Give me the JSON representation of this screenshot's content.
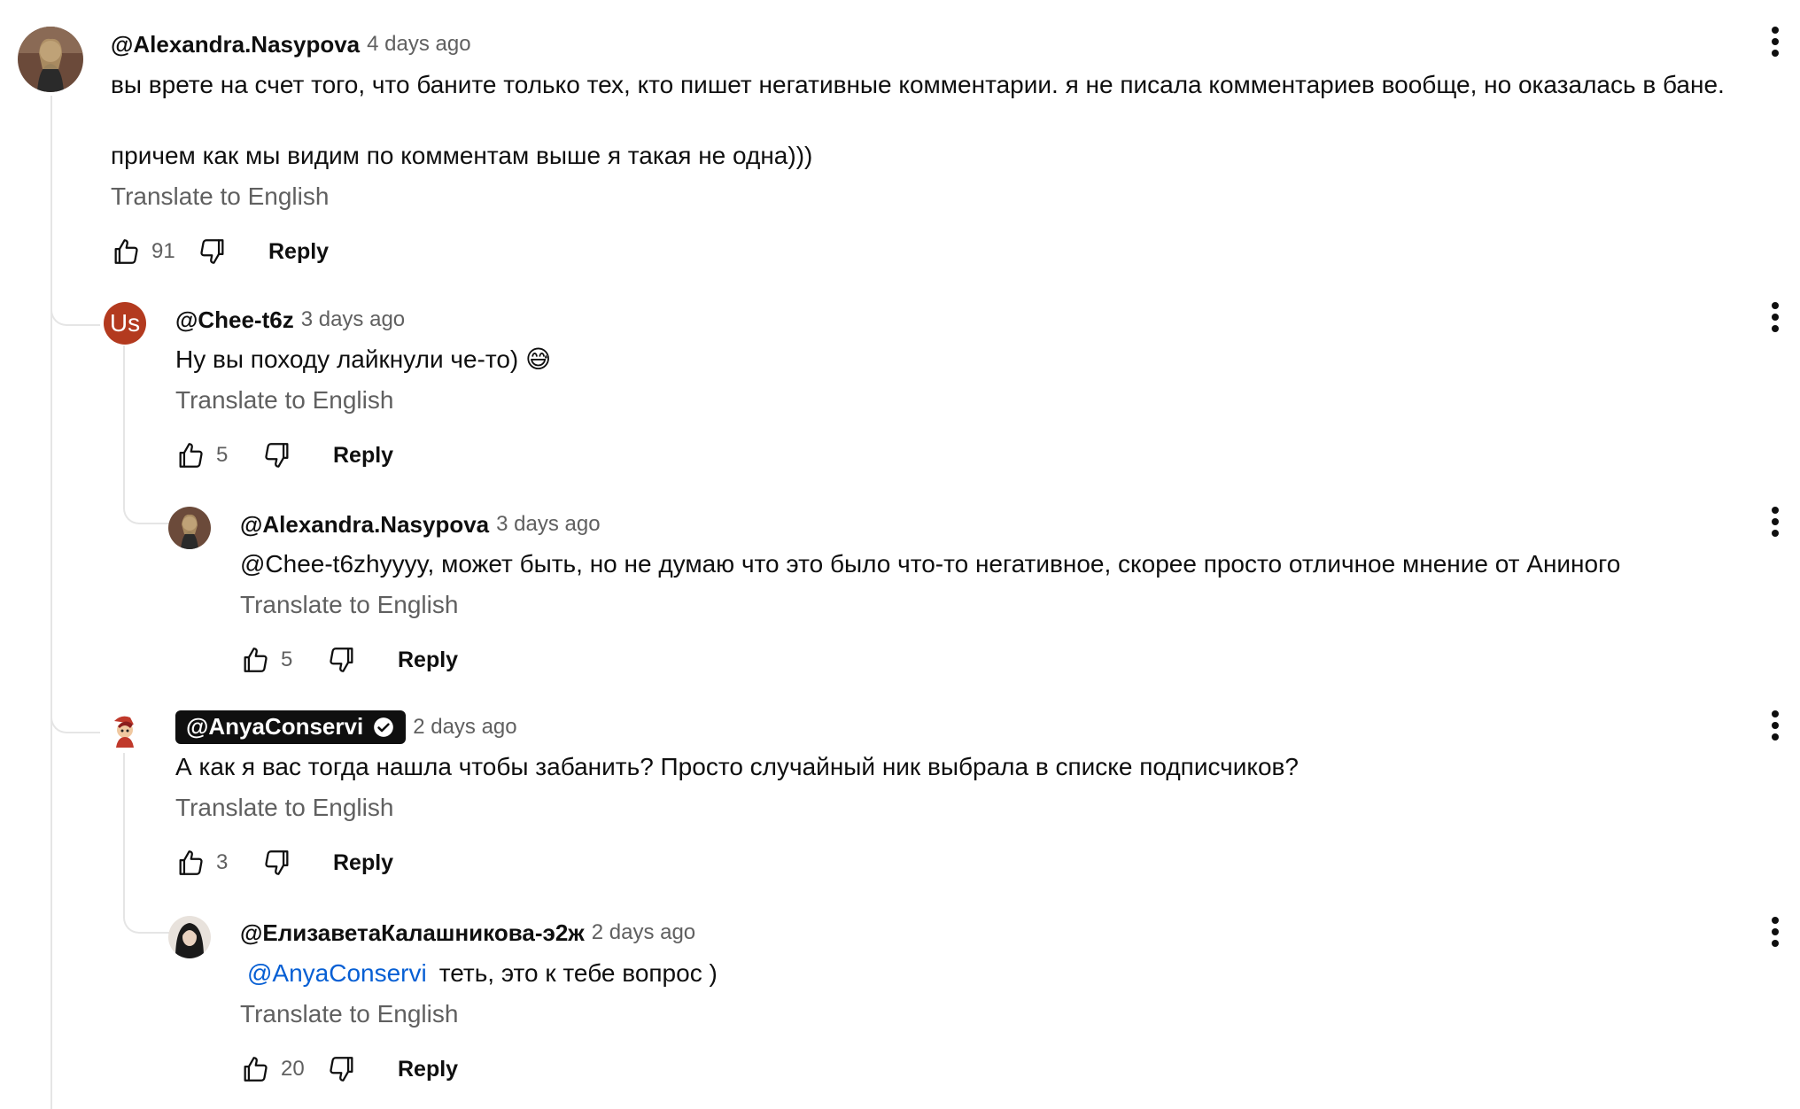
{
  "comments": [
    {
      "author": "@Alexandra.Nasypova",
      "time": "4 days ago",
      "text_line1": "вы врете на счет того, что баните только тех, кто пишет негативные комментарии. я не писала комментариев вообще, но оказалась в бане.",
      "text_line2": "причем как мы видим по комментам выше я такая не одна)))",
      "translate": "Translate to English",
      "likes": "91",
      "reply": "Reply"
    },
    {
      "author": "@Chee-t6z",
      "time": "3 days ago",
      "avatar_initials": "Us",
      "text": "Ну вы походу лайкнули че-то) 😅",
      "translate": "Translate to English",
      "likes": "5",
      "reply": "Reply"
    },
    {
      "author": "@Alexandra.Nasypova",
      "time": "3 days ago",
      "text": "@Chee-t6zhyyyy, может быть, но не думаю что это было что-то негативное, скорее просто отличное мнение от Аниного",
      "translate": "Translate to English",
      "likes": "5",
      "reply": "Reply"
    },
    {
      "author": "@AnyaConservi",
      "time": "2 days ago",
      "verified": true,
      "text": "А как я вас тогда нашла чтобы забанить? Просто случайный ник выбрала в списке подписчиков?",
      "translate": "Translate to English",
      "likes": "3",
      "reply": "Reply"
    },
    {
      "author": "@ЕлизаветаКалашникова-э2ж",
      "time": "2 days ago",
      "mention": "@AnyaConservi",
      "text": "теть, это к тебе вопрос )",
      "translate": "Translate to English",
      "likes": "20",
      "reply": "Reply"
    }
  ],
  "colors": {
    "secondary_text": "#606060",
    "mention": "#065fd4",
    "thread_line": "#e5e5e5",
    "avatar_us": "#b33a1f"
  },
  "icons": [
    "like-icon",
    "dislike-icon",
    "more-vert-icon",
    "verified-check-icon"
  ]
}
